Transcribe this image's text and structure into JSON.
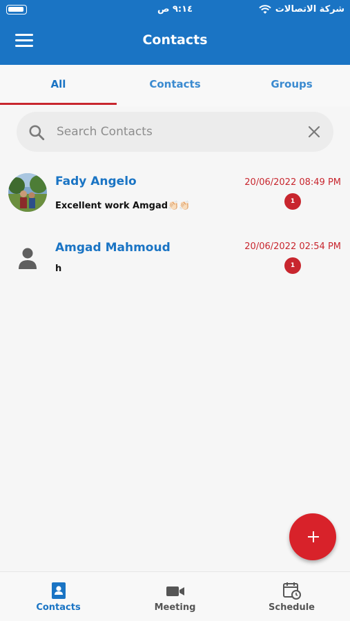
{
  "status_bar": {
    "time": "٩:١٤ ص",
    "carrier": "شركة الاتصالات"
  },
  "header": {
    "title": "Contacts",
    "menu_icon": "hamburger-menu-icon"
  },
  "tabs": [
    {
      "label": "All",
      "active": true
    },
    {
      "label": "Contacts",
      "active": false
    },
    {
      "label": "Groups",
      "active": false
    }
  ],
  "search": {
    "placeholder": "Search Contacts",
    "value": ""
  },
  "conversations": [
    {
      "name": "Fady Angelo",
      "message": "Excellent work Amgad👏🏻👏🏻",
      "date": "20/06/2022 08:49 PM",
      "unread": "1",
      "avatar": "photo"
    },
    {
      "name": "Amgad Mahmoud",
      "message": "h",
      "date": "20/06/2022 02:54 PM",
      "unread": "1",
      "avatar": "generic-person"
    }
  ],
  "fab": {
    "icon": "plus-icon"
  },
  "bottom_nav": [
    {
      "label": "Contacts",
      "icon": "contacts-book-icon",
      "active": true
    },
    {
      "label": "Meeting",
      "icon": "video-camera-icon",
      "active": false
    },
    {
      "label": "Schedule",
      "icon": "calendar-clock-icon",
      "active": false
    }
  ],
  "colors": {
    "primary": "#1a74c4",
    "accent": "#c8262e",
    "fab": "#d8222a",
    "background": "#f6f6f6"
  }
}
